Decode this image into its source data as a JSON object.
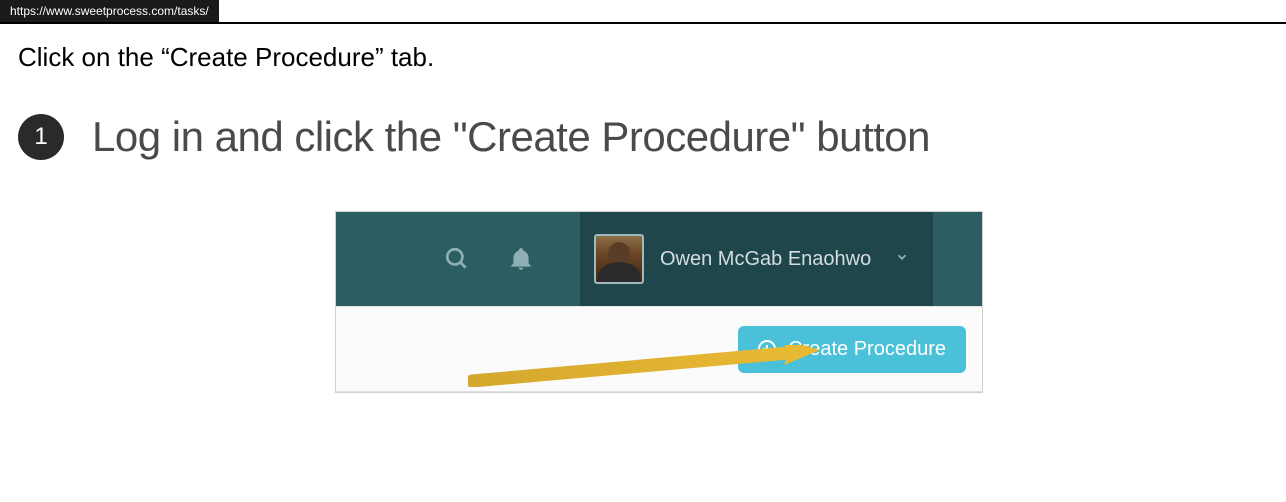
{
  "url": "https://www.sweetprocess.com/tasks/",
  "instruction": "Click on the “Create Procedure” tab.",
  "step": {
    "number": "1",
    "title": "Log in and click the \"Create Procedure\" button"
  },
  "header": {
    "search_icon": "search",
    "bell_icon": "notifications",
    "user_name": "Owen McGab Enaohwo"
  },
  "actions": {
    "create_procedure_label": "Create Procedure"
  }
}
